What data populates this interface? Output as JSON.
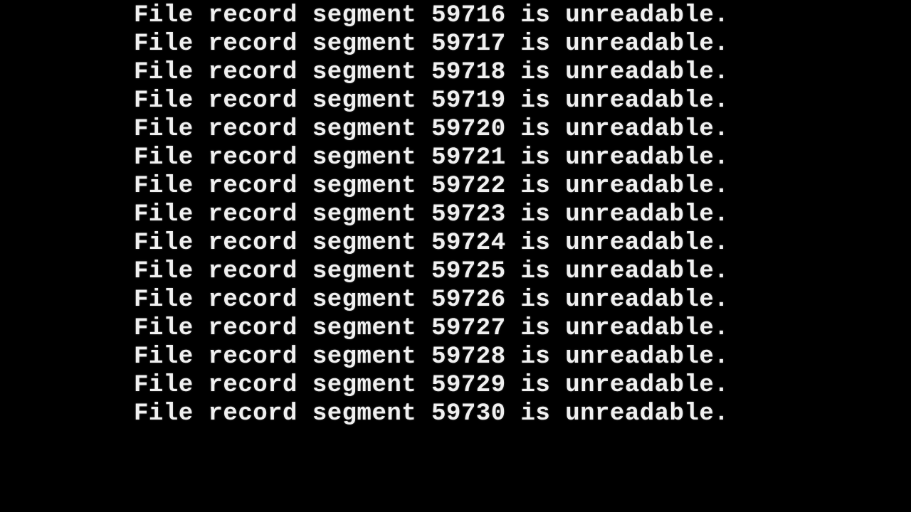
{
  "console": {
    "message_prefix": "File record segment ",
    "message_suffix": " is unreadable.",
    "lines": [
      {
        "segment": 59716
      },
      {
        "segment": 59717
      },
      {
        "segment": 59718
      },
      {
        "segment": 59719
      },
      {
        "segment": 59720
      },
      {
        "segment": 59721
      },
      {
        "segment": 59722
      },
      {
        "segment": 59723
      },
      {
        "segment": 59724
      },
      {
        "segment": 59725
      },
      {
        "segment": 59726
      },
      {
        "segment": 59727
      },
      {
        "segment": 59728
      },
      {
        "segment": 59729
      },
      {
        "segment": 59730
      }
    ]
  }
}
